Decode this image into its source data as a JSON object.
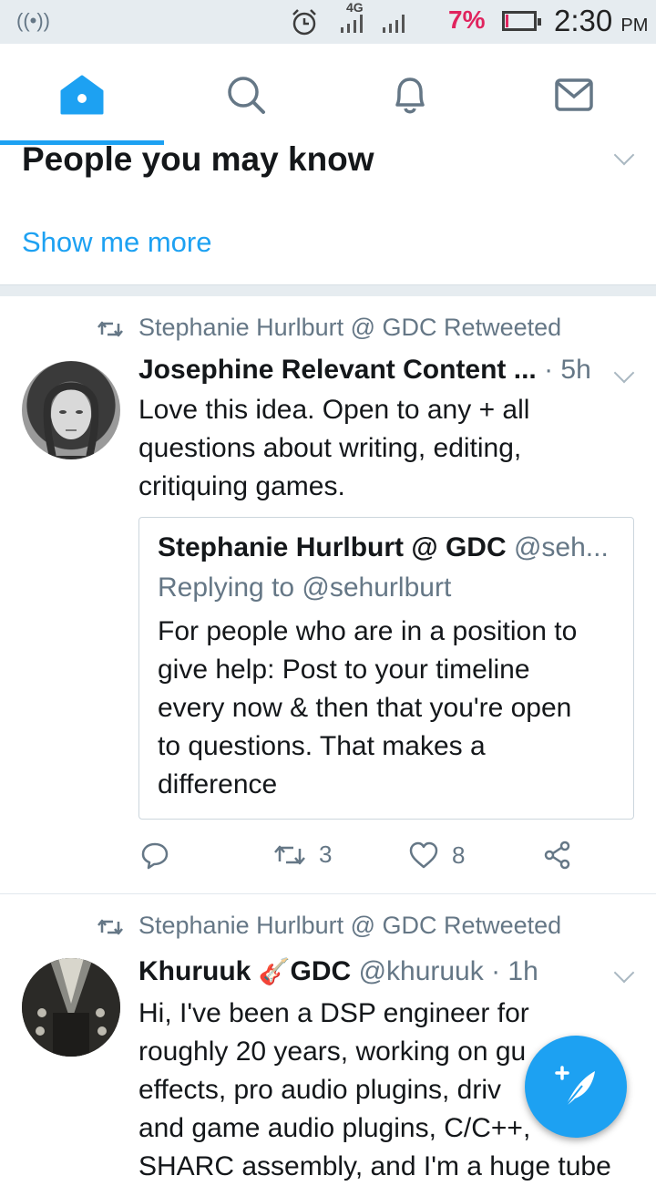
{
  "statusbar": {
    "network_label": "4G",
    "battery_percent": "7%",
    "battery_level": 0.07,
    "time": "2:30",
    "ampm": "PM"
  },
  "navbar": {
    "tabs": [
      {
        "icon": "home-icon",
        "active": true
      },
      {
        "icon": "search-icon",
        "active": false
      },
      {
        "icon": "bell-icon",
        "active": false
      },
      {
        "icon": "mail-icon",
        "active": false
      }
    ],
    "accent": "#1da1f2"
  },
  "pymk": {
    "title": "People you may know",
    "show_more": "Show me more"
  },
  "tweets": [
    {
      "retweeted_by": "Stephanie Hurlburt @ GDC Retweeted",
      "name": "Josephine Relevant Content ...",
      "meta": "· 5h",
      "text_lines": [
        "Love this idea. Open to any + all",
        "questions about writing, editing,",
        "critiquing games."
      ],
      "quote": {
        "name": "Stephanie Hurlburt @ GDC",
        "handle": "@seh...",
        "replying": "Replying to @sehurlburt",
        "text_lines": [
          "For people who are in a position to",
          "give help: Post to your timeline",
          "every now & then that you're open",
          "to questions. That makes a",
          "difference"
        ]
      },
      "retweets": "3",
      "likes": "8"
    },
    {
      "retweeted_by": "Stephanie Hurlburt @ GDC Retweeted",
      "name": "Khuruuk",
      "name_suffix": "GDC",
      "meta": "@khuruuk · 1h",
      "text_lines": [
        "Hi, I've been a DSP engineer for",
        "roughly 20 years, working on gu",
        "effects, pro audio plugins,  driv",
        "and game audio plugins, C/C++,",
        "SHARC assembly, and I'm a huge tube"
      ]
    }
  ],
  "colors": {
    "accent": "#1da1f2",
    "secondary_text": "#657786",
    "battery_low": "#e0245e"
  }
}
